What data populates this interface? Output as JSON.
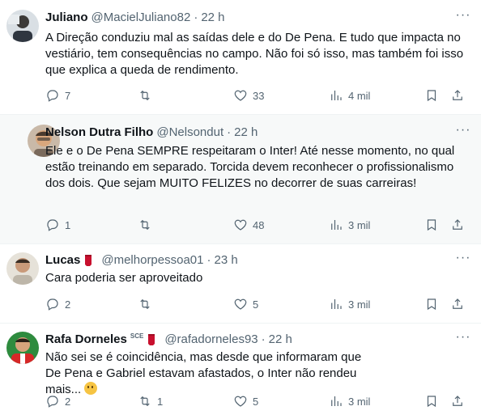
{
  "tweets": [
    {
      "name": "Juliano",
      "handle": "@MacielJuliano82",
      "time": "22 h",
      "text": "A Direção conduziu mal as saídas dele e do De Pena. E tudo que impacta no vestiário, tem consequências no campo. Não foi só isso, mas também foi isso que explica a queda de rendimento.",
      "replies": "7",
      "retweets": "",
      "likes": "33",
      "views": "4 mil"
    },
    {
      "name": "Nelson Dutra Filho",
      "handle": "@Nelsondut",
      "time": "22 h",
      "text": "Ele e o De Pena SEMPRE respeitaram o Inter! Até nesse momento, no qual estão treinando em separado. Torcida devem reconhecer o profissionalismo dos dois. Que sejam MUITO FELIZES no decorrer de suas carreiras!",
      "replies": "1",
      "retweets": "",
      "likes": "48",
      "views": "3 mil"
    },
    {
      "name": "Lucas",
      "handle": "@melhorpessoa01",
      "time": "23 h",
      "text": "Cara poderia ser aproveitado",
      "replies": "2",
      "retweets": "",
      "likes": "5",
      "views": "3 mil"
    },
    {
      "name": "Rafa Dorneles",
      "badge": "SCE",
      "handle": "@rafadorneles93",
      "time": "22 h",
      "text": "Não sei se é coincidência, mas desde que informaram que De Pena e Gabriel estavam afastados, o Inter não rendeu mais...",
      "replies": "2",
      "retweets": "1",
      "likes": "5",
      "views": "3 mil"
    }
  ],
  "colors": {
    "text": "#0f1419",
    "muted": "#536471",
    "flag_red": "#c8102e",
    "hover_bg": "#f7f9f9"
  },
  "icons": [
    "reply-icon",
    "retweet-icon",
    "like-icon",
    "views-icon",
    "bookmark-icon",
    "share-icon",
    "more-icon",
    "inter-flag-icon",
    "thinking-emoji"
  ]
}
